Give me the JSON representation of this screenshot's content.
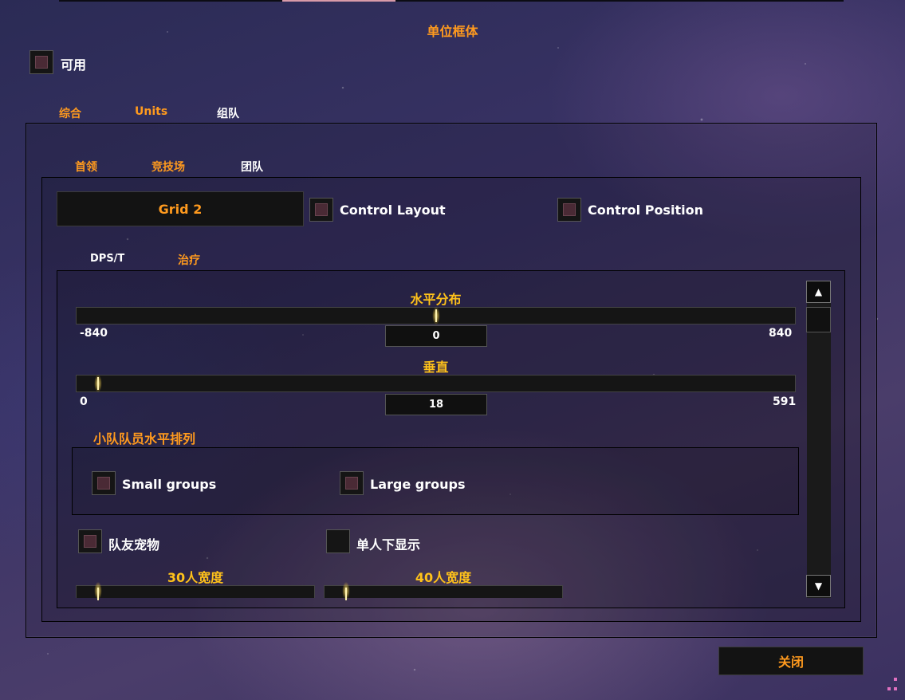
{
  "window": {
    "title": "单位框体",
    "enable_label": "可用"
  },
  "tabs_main": [
    {
      "label": "综合",
      "color": "#ff9a1e"
    },
    {
      "label": "Units",
      "color": "#ff9a1e"
    },
    {
      "label": "组队",
      "color": "#ffffff"
    }
  ],
  "tabs_sub": [
    {
      "label": "首领",
      "color": "#ff9a1e"
    },
    {
      "label": "竞技场",
      "color": "#ff9a1e"
    },
    {
      "label": "团队",
      "color": "#ffffff"
    }
  ],
  "grid_dropdown": {
    "selected": "Grid 2"
  },
  "options": {
    "control_layout": "Control Layout",
    "control_position": "Control Position"
  },
  "role_tabs": [
    {
      "label": "DPS/T",
      "color": "#ffffff"
    },
    {
      "label": "治疗",
      "color": "#ff9a1e"
    }
  ],
  "horizontal": {
    "title": "水平分布",
    "min": "-840",
    "max": "840",
    "value": "0",
    "min_num": -840,
    "max_num": 840,
    "value_num": 0
  },
  "vertical": {
    "title": "垂直",
    "min": "0",
    "max": "591",
    "value": "18",
    "min_num": 0,
    "max_num": 591,
    "value_num": 18
  },
  "group_sort": {
    "title": "小队队员水平排列",
    "small": "Small groups",
    "large": "Large groups"
  },
  "extra": {
    "pets": "队友宠物",
    "solo": "单人下显示"
  },
  "width_30": {
    "title": "30人宽度",
    "fraction": 0.09
  },
  "width_40": {
    "title": "40人宽度",
    "fraction": 0.09
  },
  "scrollbar": {
    "up_icon": "triangle-up-icon",
    "down_icon": "triangle-down-icon"
  },
  "close_button": {
    "label": "关闭"
  },
  "colors": {
    "accent": "#ff9a1e",
    "heading": "#ffc21a",
    "checkbox_fill": "#4a2a35"
  }
}
